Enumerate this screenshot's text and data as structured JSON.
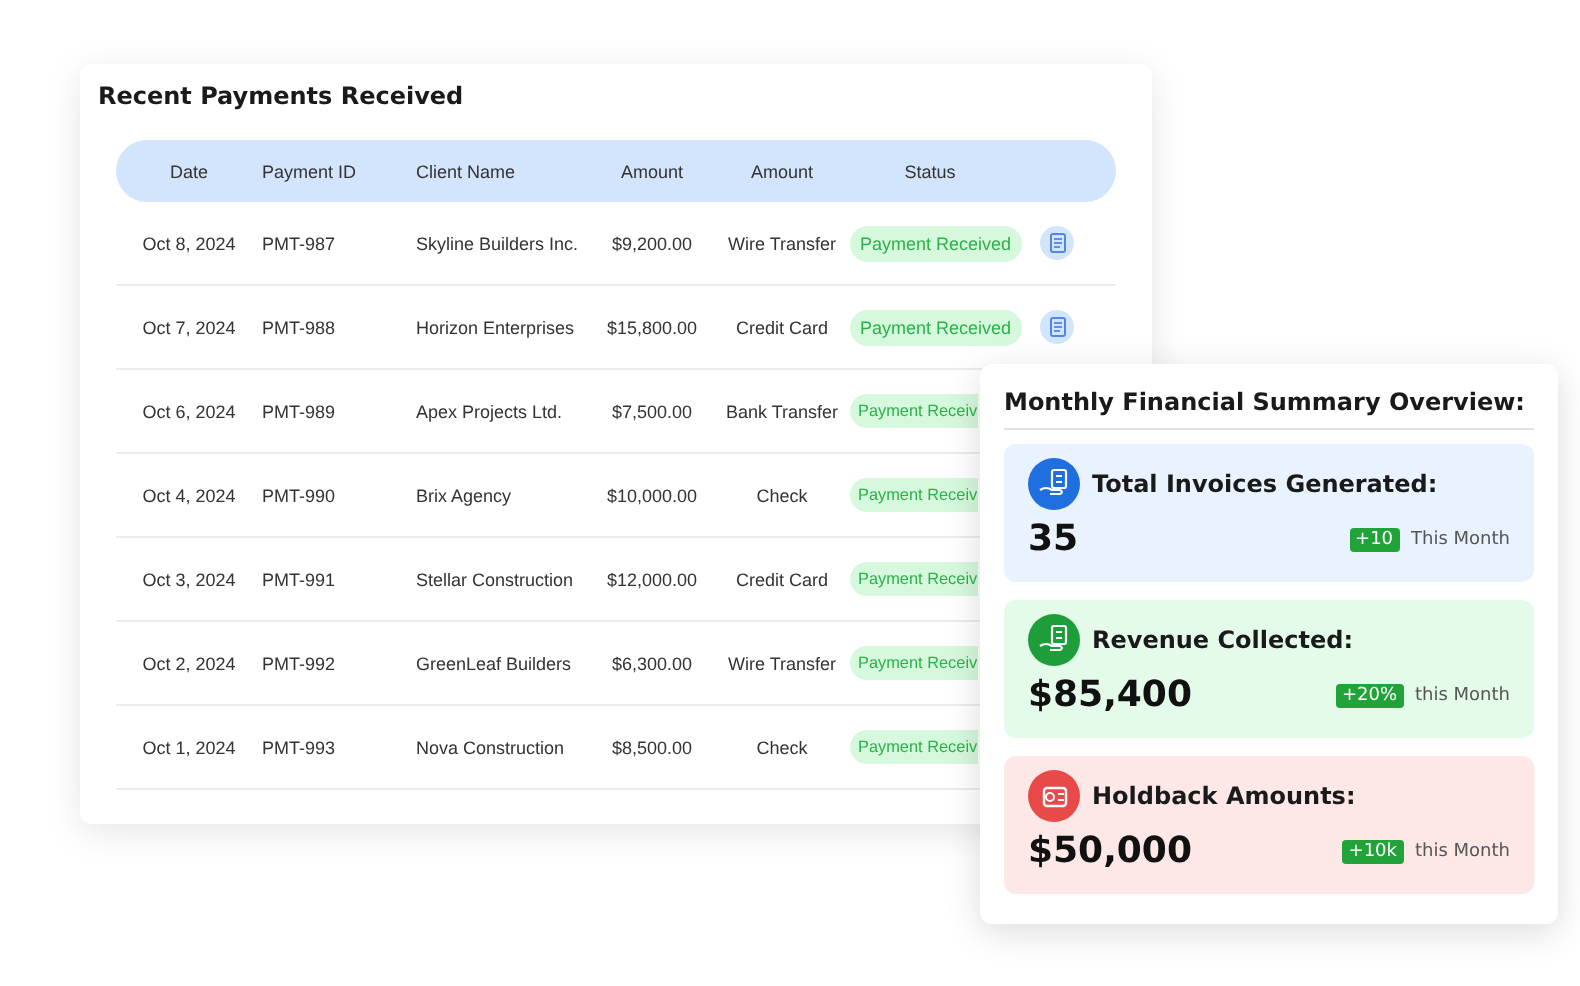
{
  "payments": {
    "title": "Recent Payments Received",
    "columns": [
      "Date",
      "Payment ID",
      "Client Name",
      "Amount",
      "Amount",
      "Status"
    ],
    "rows": [
      {
        "date": "Oct 8, 2024",
        "id": "PMT-987",
        "client": "Skyline Builders Inc.",
        "amount": "$9,200.00",
        "method": "Wire Transfer",
        "status": "Payment Received",
        "status_cut": false,
        "action_icon": true
      },
      {
        "date": "Oct 7, 2024",
        "id": "PMT-988",
        "client": "Horizon Enterprises",
        "amount": "$15,800.00",
        "method": "Credit Card",
        "status": "Payment Received",
        "status_cut": false,
        "action_icon": true
      },
      {
        "date": "Oct 6, 2024",
        "id": "PMT-989",
        "client": "Apex Projects Ltd.",
        "amount": "$7,500.00",
        "method": "Bank Transfer",
        "status": "Payment Receiv",
        "status_cut": true,
        "action_icon": false
      },
      {
        "date": "Oct 4, 2024",
        "id": "PMT-990",
        "client": "Brix Agency",
        "amount": "$10,000.00",
        "method": "Check",
        "status": "Payment Receiv",
        "status_cut": true,
        "action_icon": false
      },
      {
        "date": "Oct 3, 2024",
        "id": "PMT-991",
        "client": "Stellar Construction",
        "amount": "$12,000.00",
        "method": "Credit Card",
        "status": "Payment Receiv",
        "status_cut": true,
        "action_icon": false
      },
      {
        "date": "Oct 2, 2024",
        "id": "PMT-992",
        "client": "GreenLeaf Builders",
        "amount": "$6,300.00",
        "method": "Wire Transfer",
        "status": "Payment Receiv",
        "status_cut": true,
        "action_icon": false
      },
      {
        "date": "Oct 1, 2024",
        "id": "PMT-993",
        "client": "Nova Construction",
        "amount": "$8,500.00",
        "method": "Check",
        "status": "Payment Receiv",
        "status_cut": true,
        "action_icon": false
      }
    ]
  },
  "summary": {
    "title": "Monthly Financial Summary Overview:",
    "items": [
      {
        "kind": "invoices",
        "label": "Total Invoices Generated:",
        "value": "35",
        "change": "+10",
        "period": "This Month"
      },
      {
        "kind": "revenue",
        "label": "Revenue Collected:",
        "value": "$85,400",
        "change": "+20%",
        "period": "this Month"
      },
      {
        "kind": "holdback",
        "label": "Holdback Amounts:",
        "value": "$50,000",
        "change": "+10k",
        "period": "this Month"
      }
    ]
  }
}
